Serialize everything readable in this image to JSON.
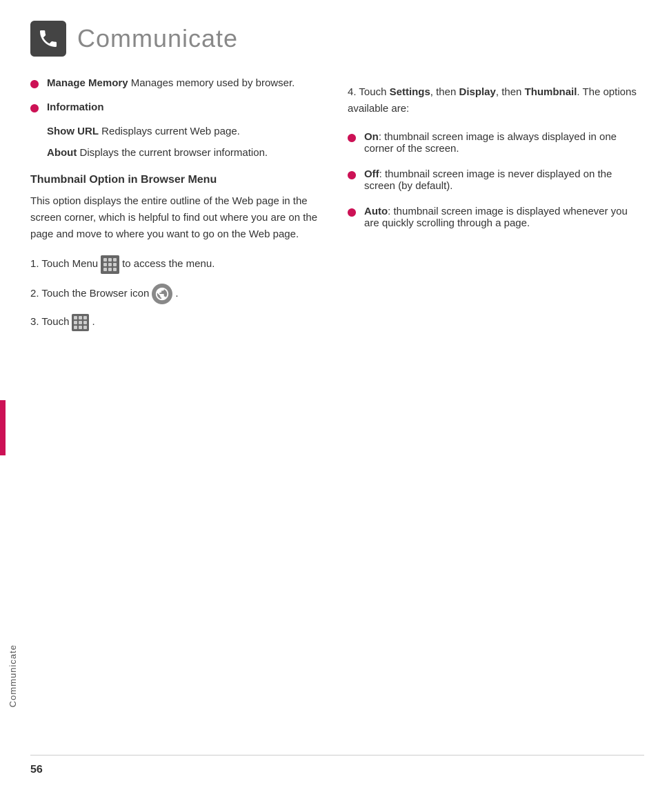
{
  "header": {
    "title": "Communicate",
    "icon_alt": "phone-icon"
  },
  "sidebar": {
    "label": "Communicate"
  },
  "left_column": {
    "bullet1": {
      "term": "Manage Memory",
      "text": " Manages memory used by browser."
    },
    "bullet2": {
      "term": "Information"
    },
    "info_sub": {
      "show_url_term": "Show URL",
      "show_url_text": " Redisplays current Web page.",
      "about_term": "About",
      "about_text": " Displays the current browser information."
    },
    "thumbnail_heading": "Thumbnail Option in Browser Menu",
    "thumbnail_desc": "This option displays the entire outline of the Web page in the screen corner, which is helpful to find out where you are on the page and move to where you want to go on the Web page.",
    "step1_prefix": "1. Touch Menu",
    "step1_suffix": "to access the menu.",
    "step2_prefix": "2. Touch the Browser icon",
    "step2_suffix": ".",
    "step3_prefix": "3. Touch",
    "step3_suffix": "."
  },
  "right_column": {
    "step4_text": "4. Touch ",
    "step4_bold1": "Settings",
    "step4_mid1": ", then ",
    "step4_bold2": "Display",
    "step4_mid2": ", then ",
    "step4_bold3": "Thumbnail",
    "step4_end": ". The options available are:",
    "bullet_on_term": "On",
    "bullet_on_text": ": thumbnail screen image is always displayed in one corner of the screen.",
    "bullet_off_term": "Off",
    "bullet_off_text": ": thumbnail screen image is never displayed on the screen (by default).",
    "bullet_auto_term": "Auto",
    "bullet_auto_text": ": thumbnail screen image is displayed whenever you are quickly scrolling through a page."
  },
  "page_number": "56"
}
